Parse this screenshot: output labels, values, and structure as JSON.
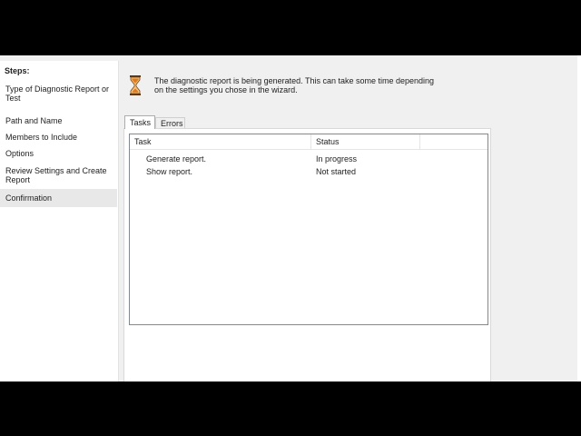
{
  "sidebar": {
    "heading": "Steps:",
    "items": [
      {
        "label": "Type of Diagnostic Report or Test"
      },
      {
        "label": "Path and Name"
      },
      {
        "label": "Members to Include"
      },
      {
        "label": "Options"
      },
      {
        "label": "Review Settings and Create Report"
      },
      {
        "label": "Confirmation"
      }
    ],
    "active_index": 5
  },
  "main": {
    "icon": "hourglass-icon",
    "message": "The diagnostic report is being generated. This can take some time depending on the settings you chose in the wizard.",
    "tabs": [
      {
        "label": "Tasks"
      },
      {
        "label": "Errors"
      }
    ],
    "active_tab": 0,
    "table": {
      "columns": [
        "Task",
        "Status"
      ],
      "rows": [
        {
          "task": "Generate report.",
          "status": "In progress"
        },
        {
          "task": "Show report.",
          "status": "Not started"
        }
      ]
    }
  },
  "colors": {
    "background": "#f0f0f0",
    "sidebar_bg": "#ffffff",
    "active_step_bg": "#e8e8e8",
    "hourglass_orange": "#e07a1f"
  }
}
